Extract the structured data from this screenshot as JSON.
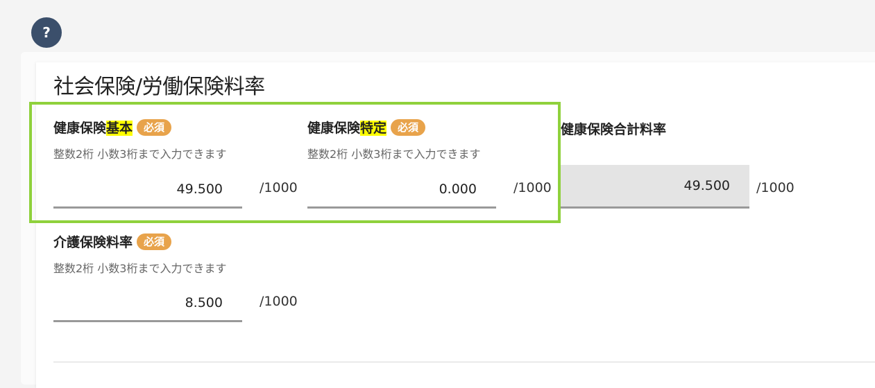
{
  "help_button": {
    "label": "?"
  },
  "section": {
    "title": "社会保険/労働保険料率"
  },
  "fields": {
    "kihon": {
      "label_pre": "健康保険",
      "label_hl": "基本",
      "required": "必須",
      "hint": "整数2桁 小数3桁まで入力できます",
      "value": "49.500",
      "unit": "/1000"
    },
    "tokutei": {
      "label_pre": "健康保険",
      "label_hl": "特定",
      "required": "必須",
      "hint": "整数2桁 小数3桁まで入力できます",
      "value": "0.000",
      "unit": "/1000"
    },
    "total": {
      "label": "健康保険合計料率",
      "value": "49.500",
      "unit": "/1000"
    },
    "kaigo": {
      "label": "介護保険料率",
      "required": "必須",
      "hint": "整数2桁 小数3桁まで入力できます",
      "value": "8.500",
      "unit": "/1000"
    }
  },
  "colors": {
    "help_bg": "#3b4f6b",
    "required_badge": "#e8a34b",
    "highlight_frame": "#8fd13c",
    "text_highlight": "#ffff00"
  }
}
